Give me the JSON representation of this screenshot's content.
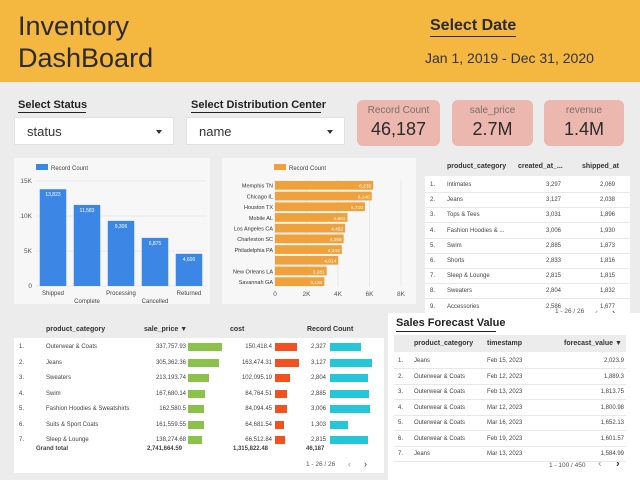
{
  "header": {
    "title_line1": "Inventory",
    "title_line2": "DashBoard",
    "select_date_label": "Select Date",
    "date_range": "Jan 1, 2019 - Dec 31, 2020"
  },
  "filters": {
    "status_label": "Select Status",
    "status_value": "status",
    "dc_label": "Select Distribution Center",
    "dc_value": "name"
  },
  "kpis": [
    {
      "label": "Record Count",
      "value": "46,187"
    },
    {
      "label": "sale_price",
      "value": "2.7M"
    },
    {
      "label": "revenue",
      "value": "1.4M"
    }
  ],
  "colors": {
    "header": "#f4b73f",
    "status_bar": "#3c87e6",
    "dc_bar": "#f0a13b",
    "sale_price_bar": "#8bc34a",
    "cost_bar": "#f4511e",
    "record_count_bar": "#26c6da",
    "kpi_bg": "#ebb7ae"
  },
  "chart_data": [
    {
      "type": "bar",
      "legend": "Record Count",
      "categories": [
        "Shipped",
        "Complete",
        "Processing",
        "Cancelled",
        "Returned"
      ],
      "values": [
        13823,
        11583,
        9306,
        6875,
        4600
      ],
      "value_labels": [
        "13,823",
        "11,583",
        "9,306",
        "6,875",
        "4,600"
      ],
      "yticks": [
        "0",
        "5K",
        "10K",
        "15K"
      ],
      "ylim": [
        0,
        15000
      ],
      "grid": true,
      "legend_position": "top"
    },
    {
      "type": "bar",
      "orientation": "horizontal",
      "legend": "Record Count",
      "categories": [
        "Memphis TN",
        "Chicago IL",
        "Houston TX",
        "Mobile AL",
        "Los Angeles CA",
        "Charleston SC",
        "Philadelphia PA",
        "",
        "New Orleans LA",
        "Savannah GA"
      ],
      "values": [
        6235,
        6140,
        5710,
        4601,
        4452,
        4358,
        4243,
        4014,
        3281,
        3134
      ],
      "value_labels": [
        "6,235",
        "6,140",
        "5,710",
        "4,601",
        "4,452",
        "4,358",
        "4,243",
        "4,014",
        "3,281",
        "3,134"
      ],
      "xticks": [
        "0",
        "2K",
        "4K",
        "6K",
        "8K"
      ],
      "xlim": [
        0,
        8000
      ],
      "grid": true,
      "legend_position": "top"
    }
  ],
  "category_table": {
    "columns": [
      "product_category",
      "created_at_...",
      "shipped_at"
    ],
    "rows": [
      {
        "n": "1.",
        "cat": "Intimates",
        "created": "3,297",
        "shipped": "2,069"
      },
      {
        "n": "2.",
        "cat": "Jeans",
        "created": "3,127",
        "shipped": "2,038"
      },
      {
        "n": "3.",
        "cat": "Tops & Tees",
        "created": "3,031",
        "shipped": "1,896"
      },
      {
        "n": "4.",
        "cat": "Fashion Hoodies & ...",
        "created": "3,006",
        "shipped": "1,930"
      },
      {
        "n": "5.",
        "cat": "Swim",
        "created": "2,885",
        "shipped": "1,873"
      },
      {
        "n": "6.",
        "cat": "Shorts",
        "created": "2,833",
        "shipped": "1,816"
      },
      {
        "n": "7.",
        "cat": "Sleep & Lounge",
        "created": "2,815",
        "shipped": "1,815"
      },
      {
        "n": "8.",
        "cat": "Sweaters",
        "created": "2,804",
        "shipped": "1,832"
      },
      {
        "n": "9.",
        "cat": "Accessories",
        "created": "2,586",
        "shipped": "1,677"
      }
    ],
    "pager": "1 - 26 / 26"
  },
  "cost_table": {
    "columns": [
      "product_category",
      "sale_price ▼",
      "cost",
      "Record Count"
    ],
    "rows": [
      {
        "n": "1.",
        "cat": "Outerwear & Coats",
        "sale": "337,757.93",
        "sale_v": 337757.93,
        "cost": "150,418.4",
        "cost_v": 150418.4,
        "count": "2,327",
        "count_v": 2327
      },
      {
        "n": "2.",
        "cat": "Jeans",
        "sale": "305,362.36",
        "sale_v": 305362.36,
        "cost": "163,474.31",
        "cost_v": 163474.31,
        "count": "3,127",
        "count_v": 3127
      },
      {
        "n": "3.",
        "cat": "Sweaters",
        "sale": "213,193.74",
        "sale_v": 213193.74,
        "cost": "102,095.19",
        "cost_v": 102095.19,
        "count": "2,804",
        "count_v": 2804
      },
      {
        "n": "4.",
        "cat": "Swim",
        "sale": "167,680.14",
        "sale_v": 167680.14,
        "cost": "84,764.51",
        "cost_v": 84764.51,
        "count": "2,885",
        "count_v": 2885
      },
      {
        "n": "5.",
        "cat": "Fashion Hoodies & Sweatshirts",
        "sale": "162,580.5",
        "sale_v": 162580.5,
        "cost": "84,094.45",
        "cost_v": 84094.45,
        "count": "3,006",
        "count_v": 3006
      },
      {
        "n": "6.",
        "cat": "Suits & Sport Coats",
        "sale": "161,559.55",
        "sale_v": 161559.55,
        "cost": "64,681.54",
        "cost_v": 64681.54,
        "count": "1,303",
        "count_v": 1303
      },
      {
        "n": "7.",
        "cat": "Sleep & Lounge",
        "sale": "138,274.68",
        "sale_v": 138274.68,
        "cost": "66,512.84",
        "cost_v": 66512.84,
        "count": "2,815",
        "count_v": 2815
      }
    ],
    "total_label": "Grand total",
    "total_sale": "2,741,664.59",
    "total_cost": "1,315,822.48",
    "total_count": "46,187",
    "pager": "1 - 26 / 26"
  },
  "forecast": {
    "title": "Sales Forecast Value",
    "columns": [
      "product_category",
      "timestamp",
      "forecast_value ▼"
    ],
    "rows": [
      {
        "n": "1.",
        "cat": "Jeans",
        "ts": "Feb 15, 2023",
        "val": "2,023.9"
      },
      {
        "n": "2.",
        "cat": "Outerwear & Coats",
        "ts": "Feb 12, 2023",
        "val": "1,889.3"
      },
      {
        "n": "3.",
        "cat": "Outerwear & Coats",
        "ts": "Feb 13, 2023",
        "val": "1,813.75"
      },
      {
        "n": "4.",
        "cat": "Outerwear & Coats",
        "ts": "Mar 12, 2023",
        "val": "1,800.98"
      },
      {
        "n": "5.",
        "cat": "Outerwear & Coats",
        "ts": "Mar 16, 2023",
        "val": "1,652.13"
      },
      {
        "n": "6.",
        "cat": "Outerwear & Coats",
        "ts": "Feb 19, 2023",
        "val": "1,601.57"
      },
      {
        "n": "7.",
        "cat": "Jeans",
        "ts": "Mar 13, 2023",
        "val": "1,584.99"
      }
    ],
    "pager": "1 - 100 / 450"
  }
}
